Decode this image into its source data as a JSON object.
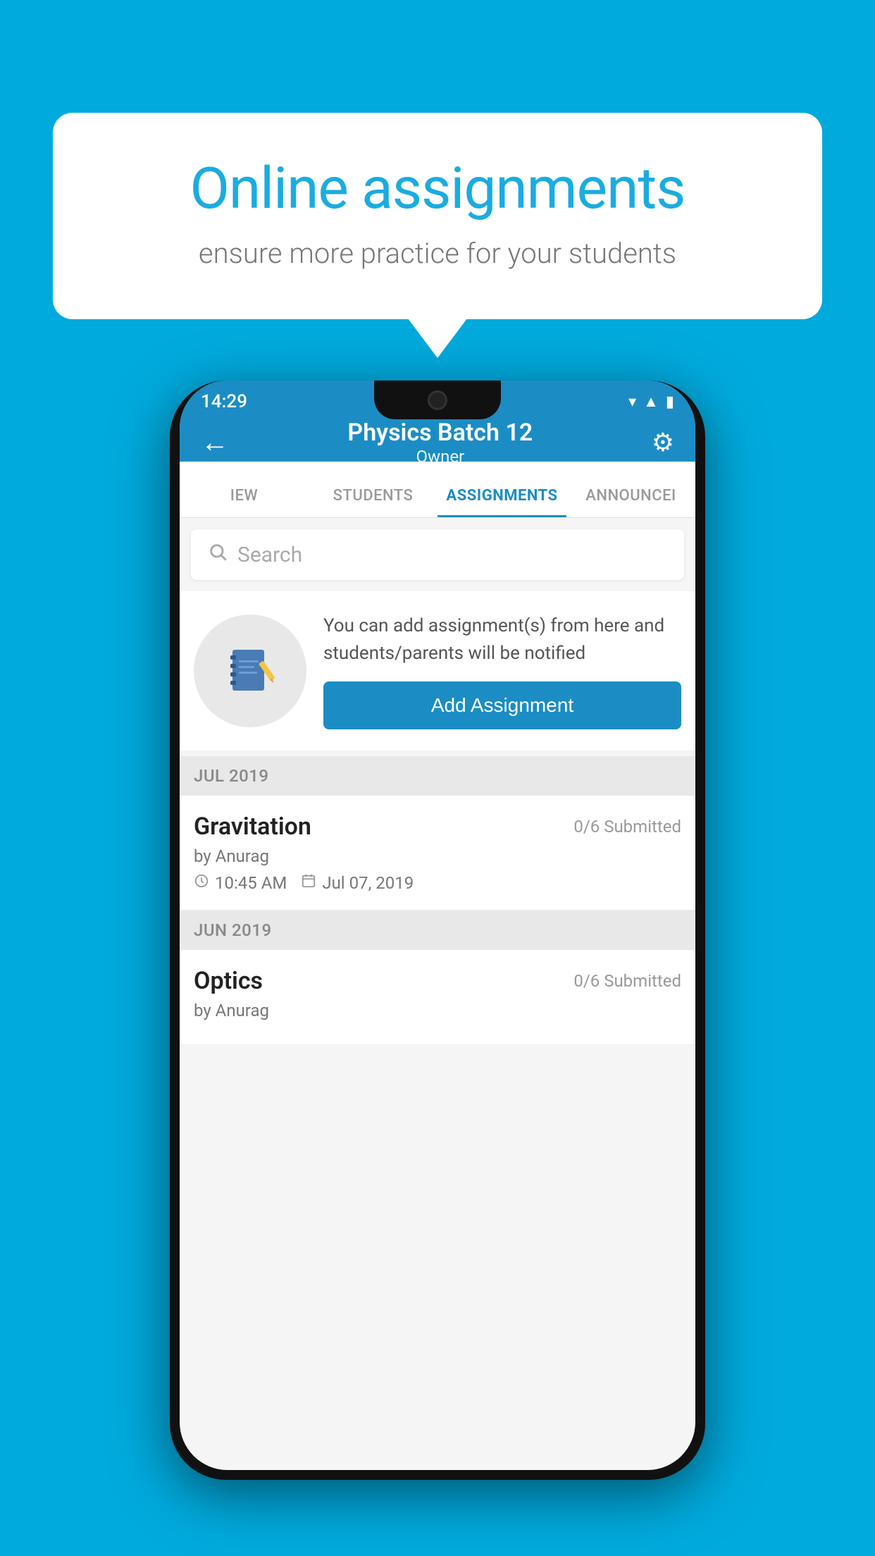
{
  "background_color": "#00AADD",
  "speech_bubble": {
    "title": "Online assignments",
    "subtitle": "ensure more practice for your students"
  },
  "status_bar": {
    "time": "14:29",
    "wifi": "▾",
    "signal": "▴",
    "battery": "▮"
  },
  "header": {
    "title": "Physics Batch 12",
    "subtitle": "Owner",
    "back_label": "←",
    "settings_label": "⚙"
  },
  "tabs": [
    {
      "label": "IEW",
      "active": false
    },
    {
      "label": "STUDENTS",
      "active": false
    },
    {
      "label": "ASSIGNMENTS",
      "active": true
    },
    {
      "label": "ANNOUNCEI",
      "active": false
    }
  ],
  "search": {
    "placeholder": "Search"
  },
  "promo": {
    "description": "You can add assignment(s) from here and students/parents will be notified",
    "button_label": "Add Assignment"
  },
  "sections": [
    {
      "month": "JUL 2019",
      "assignments": [
        {
          "name": "Gravitation",
          "submitted": "0/6 Submitted",
          "by": "by Anurag",
          "time": "10:45 AM",
          "date": "Jul 07, 2019"
        }
      ]
    },
    {
      "month": "JUN 2019",
      "assignments": [
        {
          "name": "Optics",
          "submitted": "0/6 Submitted",
          "by": "by Anurag",
          "time": "",
          "date": ""
        }
      ]
    }
  ]
}
